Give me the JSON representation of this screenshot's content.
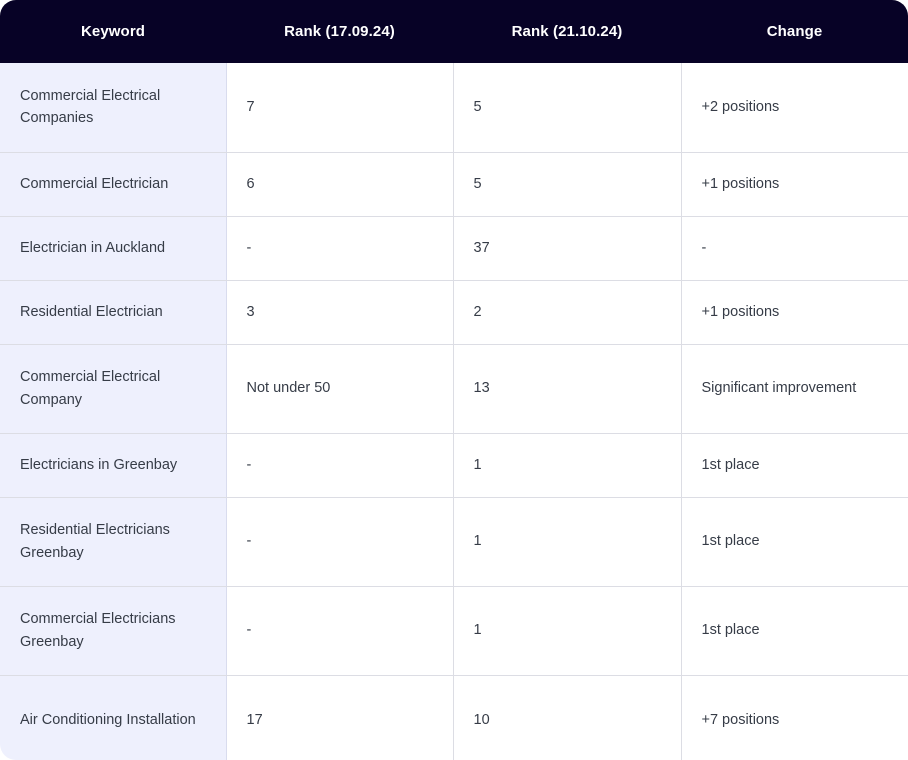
{
  "table": {
    "columns": [
      {
        "key": "keyword",
        "label": "Keyword"
      },
      {
        "key": "rank1",
        "label": "Rank (17.09.24)"
      },
      {
        "key": "rank2",
        "label": "Rank (21.10.24)"
      },
      {
        "key": "change",
        "label": "Change"
      }
    ],
    "colors": {
      "header_background": "#070226",
      "header_text": "#ffffff",
      "keyword_column_background": "#eef0fd",
      "cell_background": "#ffffff",
      "cell_text": "#363c47",
      "border": "#dcdde4"
    },
    "rows": [
      {
        "keyword": "Commercial Electrical Companies",
        "rank1": "7",
        "rank2": "5",
        "change": "+2 positions"
      },
      {
        "keyword": "Commercial Electrician",
        "rank1": "6",
        "rank2": "5",
        "change": "+1 positions"
      },
      {
        "keyword": "Electrician in Auckland",
        "rank1": "-",
        "rank2": "37",
        "change": "-"
      },
      {
        "keyword": "Residential Electrician",
        "rank1": "3",
        "rank2": "2",
        "change": "+1 positions"
      },
      {
        "keyword": "Commercial Electrical Company",
        "rank1": "Not under 50",
        "rank2": "13",
        "change": "Significant improvement"
      },
      {
        "keyword": "Electricians in Greenbay",
        "rank1": "-",
        "rank2": "1",
        "change": "1st place"
      },
      {
        "keyword": "Residential Electricians Greenbay",
        "rank1": "-",
        "rank2": "1",
        "change": "1st place"
      },
      {
        "keyword": "Commercial Electricians Greenbay",
        "rank1": "-",
        "rank2": "1",
        "change": "1st place"
      },
      {
        "keyword": "Air Conditioning Installation",
        "rank1": "17",
        "rank2": "10",
        "change": "+7 positions"
      }
    ]
  }
}
